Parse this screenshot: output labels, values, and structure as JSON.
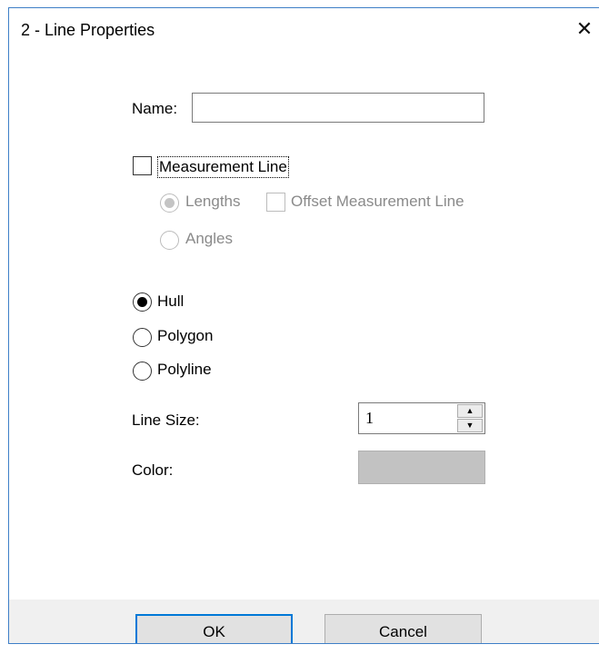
{
  "window": {
    "title": "2 - Line Properties",
    "close_glyph": "✕"
  },
  "name_field": {
    "label": "Name:",
    "value": "",
    "placeholder": ""
  },
  "measurement": {
    "checkbox_label": "Measurement Line",
    "checked": false,
    "lengths_label": "Lengths",
    "offset_label": "Offset Measurement Line",
    "angles_label": "Angles"
  },
  "line_type": {
    "options": [
      "Hull",
      "Polygon",
      "Polyline"
    ],
    "selected": "Hull"
  },
  "line_size": {
    "label": "Line Size:",
    "value": "1",
    "up_glyph": "▲",
    "down_glyph": "▼"
  },
  "color": {
    "label": "Color:",
    "value": "#c2c2c2"
  },
  "buttons": {
    "ok": "OK",
    "cancel": "Cancel"
  },
  "colors": {
    "accent": "#0078d7",
    "window_border": "#3e7fc7",
    "footer_bg": "#f0f0f0"
  }
}
